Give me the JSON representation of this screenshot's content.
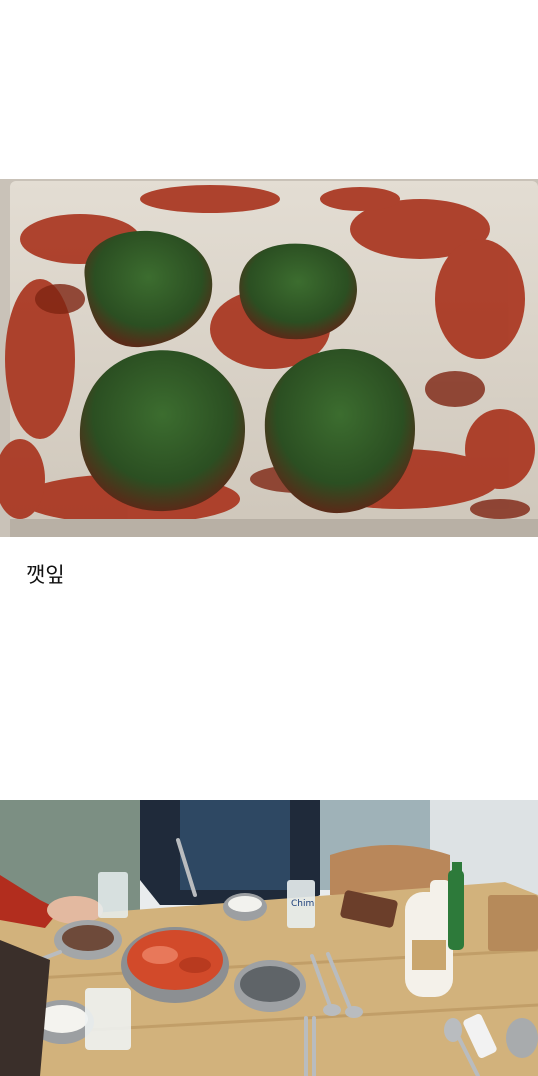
{
  "post": {
    "caption": "깻잎",
    "images": [
      {
        "subject": "perilla-leaf-kimchi-tray",
        "colors": {
          "tray": "#d9d4cc",
          "paste": "#a8321c",
          "leaf": "#2f5a26"
        }
      },
      {
        "subject": "korean-dinner-table",
        "colors": {
          "table": "#d2b27c",
          "kimchi": "#d24a2a",
          "wall": "#e9ecee"
        },
        "label_text": "Chim"
      }
    ]
  }
}
